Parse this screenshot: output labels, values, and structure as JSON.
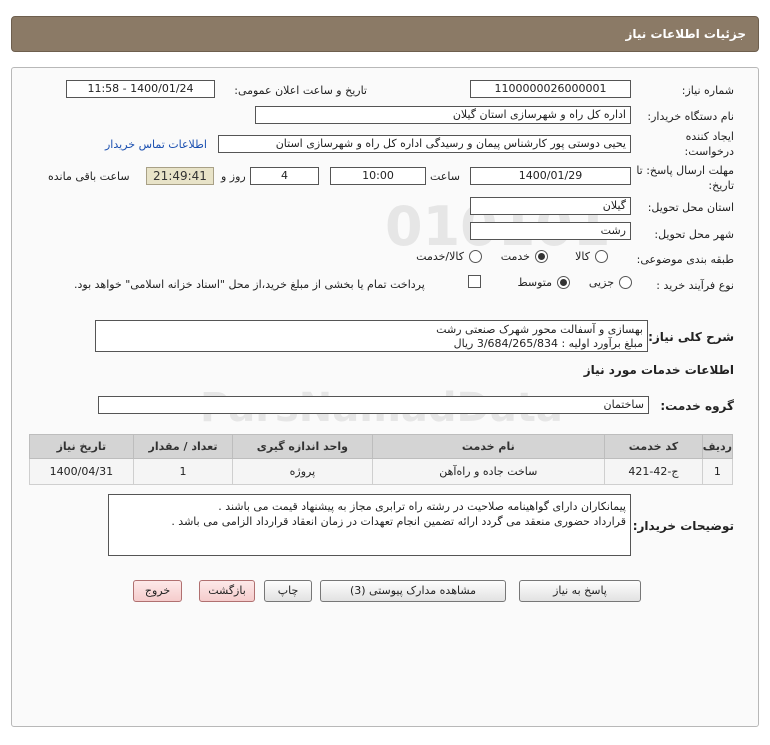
{
  "header": {
    "title": "جزئیات اطلاعات نیاز"
  },
  "form": {
    "need_number_label": "شماره نیاز:",
    "need_number": "1100000026000001",
    "announce_datetime_label": "تاریخ و ساعت اعلان عمومی:",
    "announce_datetime": "1400/01/24 - 11:58",
    "buyer_org_label": "نام دستگاه خریدار:",
    "buyer_org": "اداره کل راه و شهرسازی استان گیلان",
    "requester_label": "ایجاد کننده درخواست:",
    "requester": "یحیی دوستی پور کارشناس پیمان و رسیدگی اداره کل راه و شهرسازی استان",
    "contact_link": "اطلاعات تماس خریدار",
    "deadline_label": "مهلت ارسال پاسخ: تا تاریخ:",
    "deadline_date": "1400/01/29",
    "time_label": "ساعت",
    "deadline_time": "10:00",
    "days_value": "4",
    "days_label": "روز و",
    "remaining_time": "21:49:41",
    "remaining_label": "ساعت باقی مانده",
    "province_label": "استان محل تحویل:",
    "province": "گیلان",
    "city_label": "شهر محل تحویل:",
    "city": "رشت",
    "category_label": "طبقه بندی موضوعی:",
    "category_options": [
      "کالا",
      "خدمت",
      "کالا/خدمت"
    ],
    "category_selected": "خدمت",
    "process_label": "نوع فرآیند خرید :",
    "process_options": [
      "جزیی",
      "متوسط"
    ],
    "process_selected": "متوسط",
    "payment_note": "پرداخت تمام یا بخشی از مبلغ خرید،از محل \"اسناد خزانه اسلامی\" خواهد بود."
  },
  "description": {
    "label": "شرح کلی نیاز:",
    "line1": "بهسازی و آسفالت محور شهرک صنعتی رشت",
    "line2": "مبلغ برآورد اولیه : 3/684/265/834 ریال"
  },
  "services": {
    "section_title": "اطلاعات خدمات مورد نیاز",
    "group_label": "گروه خدمت:",
    "group_value": "ساختمان",
    "columns": [
      "ردیف",
      "کد خدمت",
      "نام خدمت",
      "واحد اندازه گیری",
      "تعداد / مقدار",
      "تاریخ نیاز"
    ],
    "rows": [
      [
        "1",
        "ج-42-421",
        "ساخت جاده و راه‌آهن",
        "پروژه",
        "1",
        "1400/04/31"
      ]
    ]
  },
  "buyer_notes": {
    "label": "توضیحات خریدار:",
    "line1": "پیمانکاران دارای گواهینامه صلاحیت در رشته راه ترابری مجاز به پیشنهاد قیمت می باشند .",
    "line2": "قرارداد حضوری منعقد می گردد ارائه تضمین انجام تعهدات در زمان انعقاد قرارداد الزامی می باشد ."
  },
  "buttons": {
    "reply": "پاسخ به نیاز",
    "attachments": "مشاهده مدارک پیوستی (3)",
    "print": "چاپ",
    "back": "بازگشت",
    "exit": "خروج"
  },
  "watermark": {
    "text": "ParsNamadData",
    "digits": "010101"
  },
  "colors": {
    "header_bg": "#8b7a66",
    "link": "#1a4fb0",
    "remaining_bg": "#e8e3c8",
    "red_button": "#f5cccc"
  }
}
